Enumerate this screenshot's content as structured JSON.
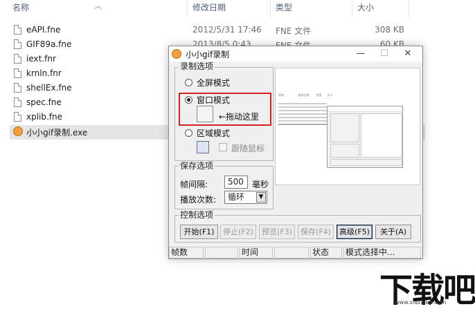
{
  "explorer": {
    "columns": {
      "name": "名称",
      "date": "修改日期",
      "type": "类型",
      "size": "大小"
    },
    "files": [
      {
        "name": "eAPI.fne",
        "date": "2012/5/31 17:46",
        "type": "FNE 文件",
        "size": "308 KB",
        "icon": "document-icon"
      },
      {
        "name": "GIF89a.fne",
        "date": "2013/8/5 0:43",
        "type": "FNE 文件",
        "size": "60 KB",
        "icon": "document-icon"
      },
      {
        "name": "iext.fnr",
        "date": "",
        "type": "",
        "size": "",
        "icon": "document-icon"
      },
      {
        "name": "krnln.fnr",
        "date": "",
        "type": "",
        "size": "",
        "icon": "document-icon"
      },
      {
        "name": "shellEx.fne",
        "date": "",
        "type": "",
        "size": "",
        "icon": "document-icon"
      },
      {
        "name": "spec.fne",
        "date": "",
        "type": "",
        "size": "",
        "icon": "document-icon"
      },
      {
        "name": "xplib.fne",
        "date": "",
        "type": "",
        "size": "",
        "icon": "document-icon"
      },
      {
        "name": "小小gif录制.exe",
        "date": "",
        "type": "",
        "size": "",
        "icon": "app-exe-icon"
      }
    ]
  },
  "app": {
    "title": "小小gif录制",
    "titlebar_buttons": {
      "minimize": "—",
      "maximize": "☐",
      "close": "✕"
    },
    "record_options": {
      "legend": "录制选项",
      "fullscreen": "全屏模式",
      "window": "窗口模式",
      "drag_hint": "←拖动这里",
      "region": "区域模式",
      "follow_mouse": "跟随鼠标"
    },
    "save_options": {
      "legend": "保存选项",
      "interval_label": "帧间隔:",
      "interval_value": "500",
      "interval_unit": "毫秒",
      "loop_label": "播放次数:",
      "loop_value": "循环"
    },
    "control_options": {
      "legend": "控制选项",
      "buttons": [
        "开始(F1)",
        "停止(F2)",
        "预览(F3)",
        "保存(F4)",
        "高级(F5)",
        "关于(A)"
      ]
    },
    "status_bar": {
      "frames_label": "帧数",
      "time_label": "时间",
      "status_label": "状态",
      "status_value": "模式选择中..."
    }
  },
  "annotation_color": "#d42020",
  "watermark": {
    "text": "下载吧",
    "url": "www.xiazaiba.com"
  }
}
